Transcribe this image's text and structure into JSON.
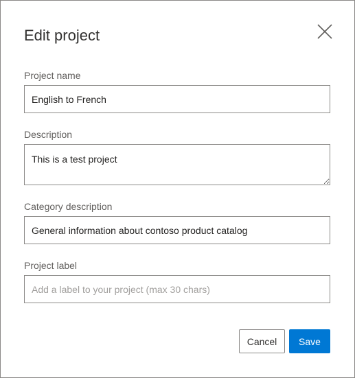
{
  "dialog": {
    "title": "Edit project",
    "close_icon": "close-icon"
  },
  "fields": {
    "project_name": {
      "label": "Project name",
      "value": "English to French"
    },
    "description": {
      "label": "Description",
      "value": "This is a test project"
    },
    "category_description": {
      "label": "Category description",
      "value": "General information about contoso product catalog"
    },
    "project_label": {
      "label": "Project label",
      "value": "",
      "placeholder": "Add a label to your project (max 30 chars)"
    }
  },
  "buttons": {
    "cancel_label": "Cancel",
    "save_label": "Save"
  },
  "colors": {
    "primary": "#0078d4",
    "border": "#8a8886",
    "label_text": "#605e5c",
    "placeholder_text": "#a19f9d"
  }
}
